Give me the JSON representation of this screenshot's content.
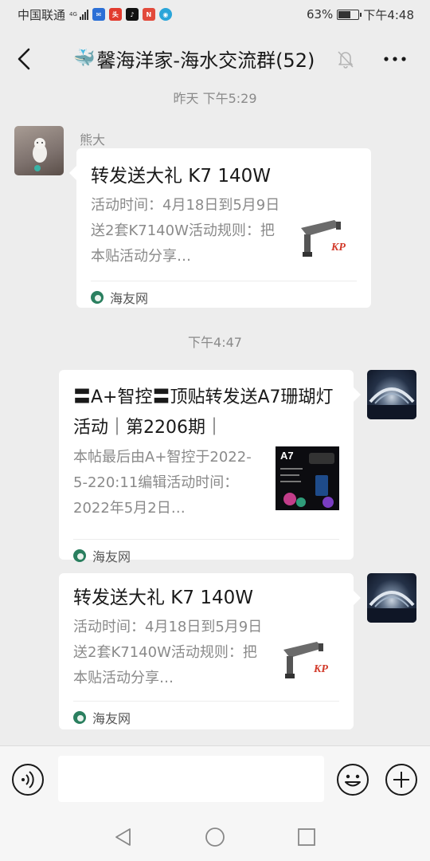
{
  "status_bar": {
    "carrier": "中国联通",
    "network": "4G",
    "battery_percent": "63%",
    "battery_level": 0.63,
    "time": "下午4:48"
  },
  "header": {
    "title_emoji": "🐳",
    "title": "馨海洋家-海水交流群(52)"
  },
  "messages": [
    {
      "timestamp": "昨天 下午5:29",
      "sender": "熊大",
      "side": "left",
      "title": "转发送大礼 K7 140W",
      "description": "活动时间：4月18日到5月9日送2套K7140W活动规则：把本贴活动分享…",
      "thumb_label": "KP",
      "source": "海友网"
    },
    {
      "timestamp": "下午4:47",
      "side": "right",
      "title": "〓A+智控〓顶贴转发送A7珊瑚灯活动｜第2206期｜",
      "description": "本帖最后由A+智控于2022-5-220:11编辑活动时间：2022年5月2日…",
      "thumb_label": "A7",
      "source": "海友网"
    },
    {
      "side": "right",
      "title": "转发送大礼 K7 140W",
      "description": "活动时间：4月18日到5月9日送2套K7140W活动规则：把本贴活动分享…",
      "thumb_label": "KP",
      "source": "海友网"
    }
  ],
  "colors": {
    "background": "#ededed",
    "card": "#ffffff",
    "secondary_text": "#8a8a8a",
    "accent_red": "#d23a2a"
  }
}
